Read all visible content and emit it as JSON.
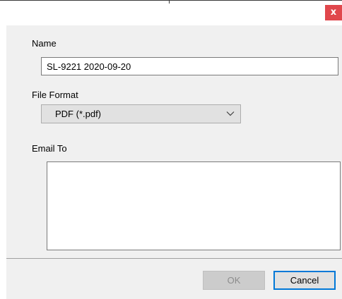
{
  "window": {
    "close_glyph": "x"
  },
  "form": {
    "name_label": "Name",
    "name_value": "SL-9221 2020-09-20",
    "file_format_label": "File Format",
    "file_format_value": "PDF (*.pdf)",
    "email_to_label": "Email To",
    "email_to_value": ""
  },
  "buttons": {
    "ok_label": "OK",
    "ok_enabled": false,
    "cancel_label": "Cancel"
  },
  "icons": {
    "close": "close-icon",
    "dropdown": "chevron-down-icon"
  },
  "colors": {
    "close_button": "#e0474c",
    "focus_border": "#0078d7",
    "panel_background": "#f0f0f0"
  }
}
